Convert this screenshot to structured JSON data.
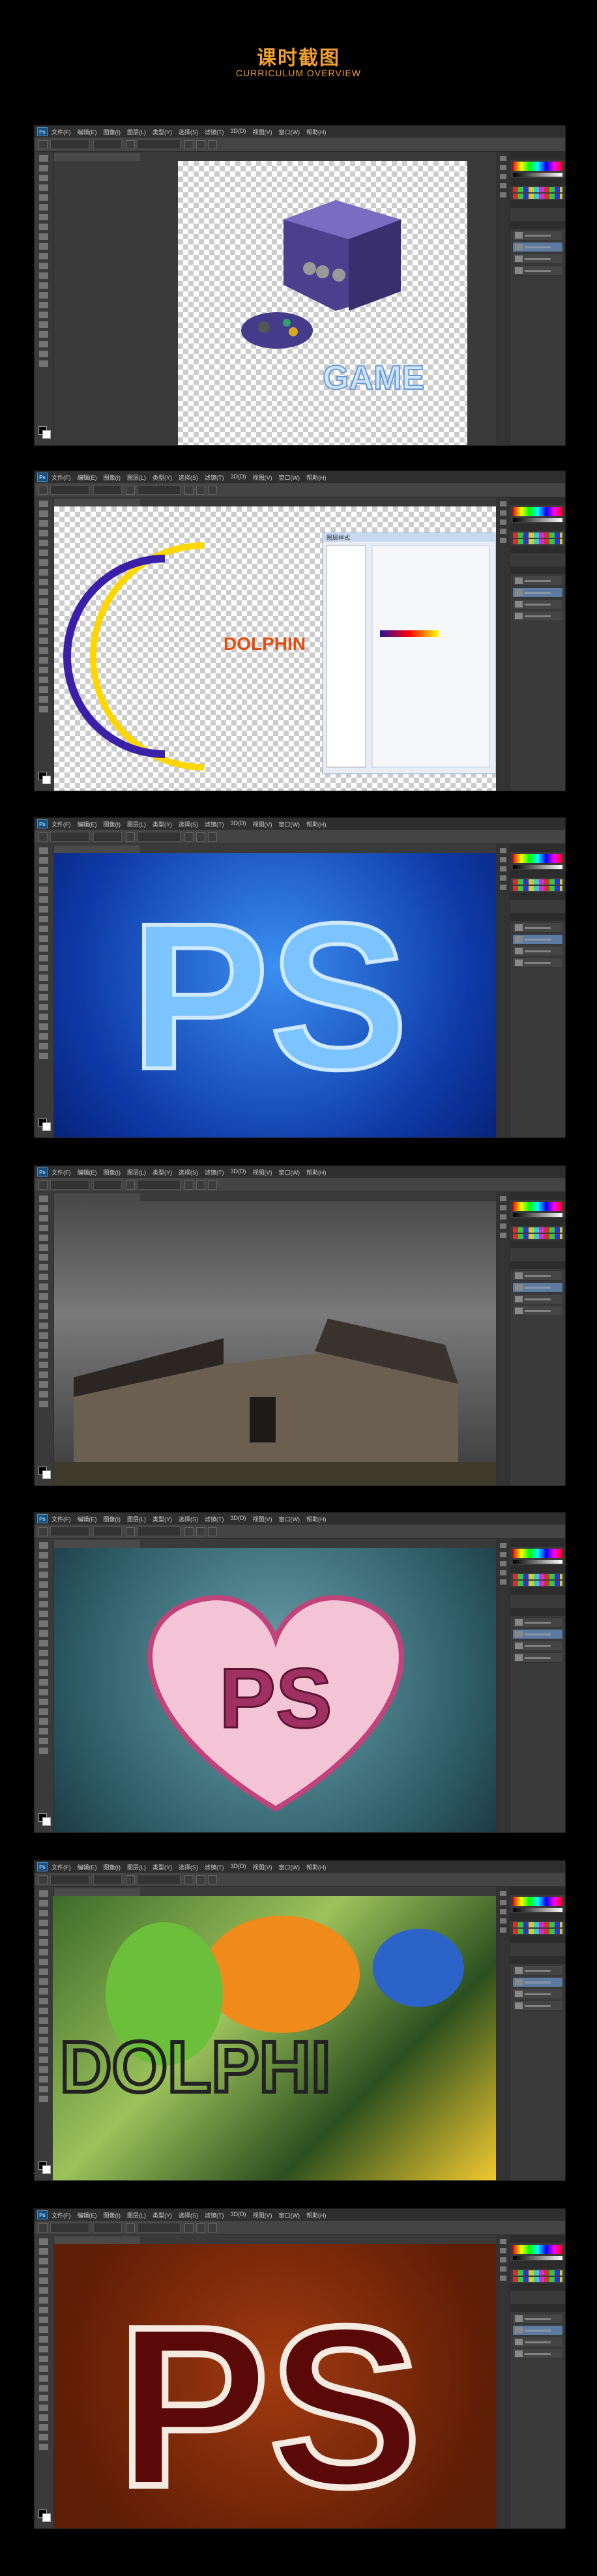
{
  "header": {
    "title": "课时截图",
    "subtitle": "CURRICULUM OVERVIEW"
  },
  "app": {
    "logo": "Ps",
    "menu": [
      "文件(F)",
      "编辑(E)",
      "图像(I)",
      "图层(L)",
      "类型(Y)",
      "选择(S)",
      "滤镜(T)",
      "3D(D)",
      "视图(V)",
      "窗口(W)",
      "帮助(H)"
    ]
  },
  "screens": [
    {
      "id": "gamecube",
      "art_text": "GAME"
    },
    {
      "id": "dolphin-moon",
      "art_text": "DOLPHIN",
      "dialog_title": "图层样式"
    },
    {
      "id": "ps-blue",
      "art_text": "PS"
    },
    {
      "id": "old-building"
    },
    {
      "id": "ps-heart",
      "art_text": "PS"
    },
    {
      "id": "parrots",
      "art_text": "DOLPHI"
    },
    {
      "id": "ps-red",
      "art_text": "PS"
    }
  ],
  "colors": {
    "accent": "#f0a030",
    "ui_dark": "#3a3a3a",
    "ui_menu": "#2e2e2e"
  }
}
